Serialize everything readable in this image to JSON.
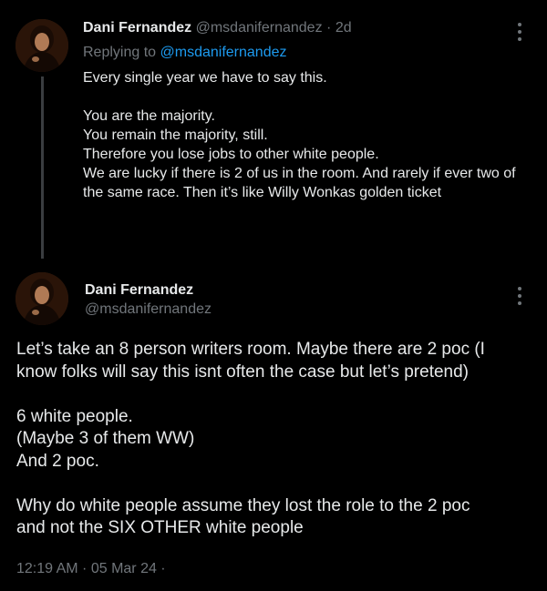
{
  "colors": {
    "background": "#000000",
    "text": "#e7e9ea",
    "muted": "#71767b",
    "link": "#1d9bf0",
    "thread_line": "#3a3d40"
  },
  "reply": {
    "author_name": "Dani Fernandez",
    "author_handle": "@msdanifernandez",
    "separator": "·",
    "time_ago": "2d",
    "replying_prefix": "Replying to",
    "replying_to": "@msdanifernandez",
    "avatar_icon": "profile-photo",
    "more_icon": "more-options-icon",
    "lines": [
      "Every single year we have to say this.",
      "",
      "You are the majority.",
      "You remain the majority, still.",
      "Therefore you lose jobs to other white people.",
      "We are lucky if there is 2 of us in the room. And rarely if ever two of",
      "the same race. Then it’s like Willy Wonkas golden ticket"
    ]
  },
  "main": {
    "author_name": "Dani Fernandez",
    "author_handle": "@msdanifernandez",
    "avatar_icon": "profile-photo",
    "more_icon": "more-options-icon",
    "lines": [
      "Let’s take an 8 person writers room. Maybe there are 2 poc (I",
      "know folks will say this isnt often the case but let’s pretend)",
      "",
      "6 white people.",
      "(Maybe 3 of them WW)",
      "And 2 poc.",
      "",
      "Why do white people assume they lost the role to the 2 poc",
      "and not the SIX OTHER white people"
    ],
    "timestamp": "12:19 AM · 05 Mar 24 ·"
  }
}
